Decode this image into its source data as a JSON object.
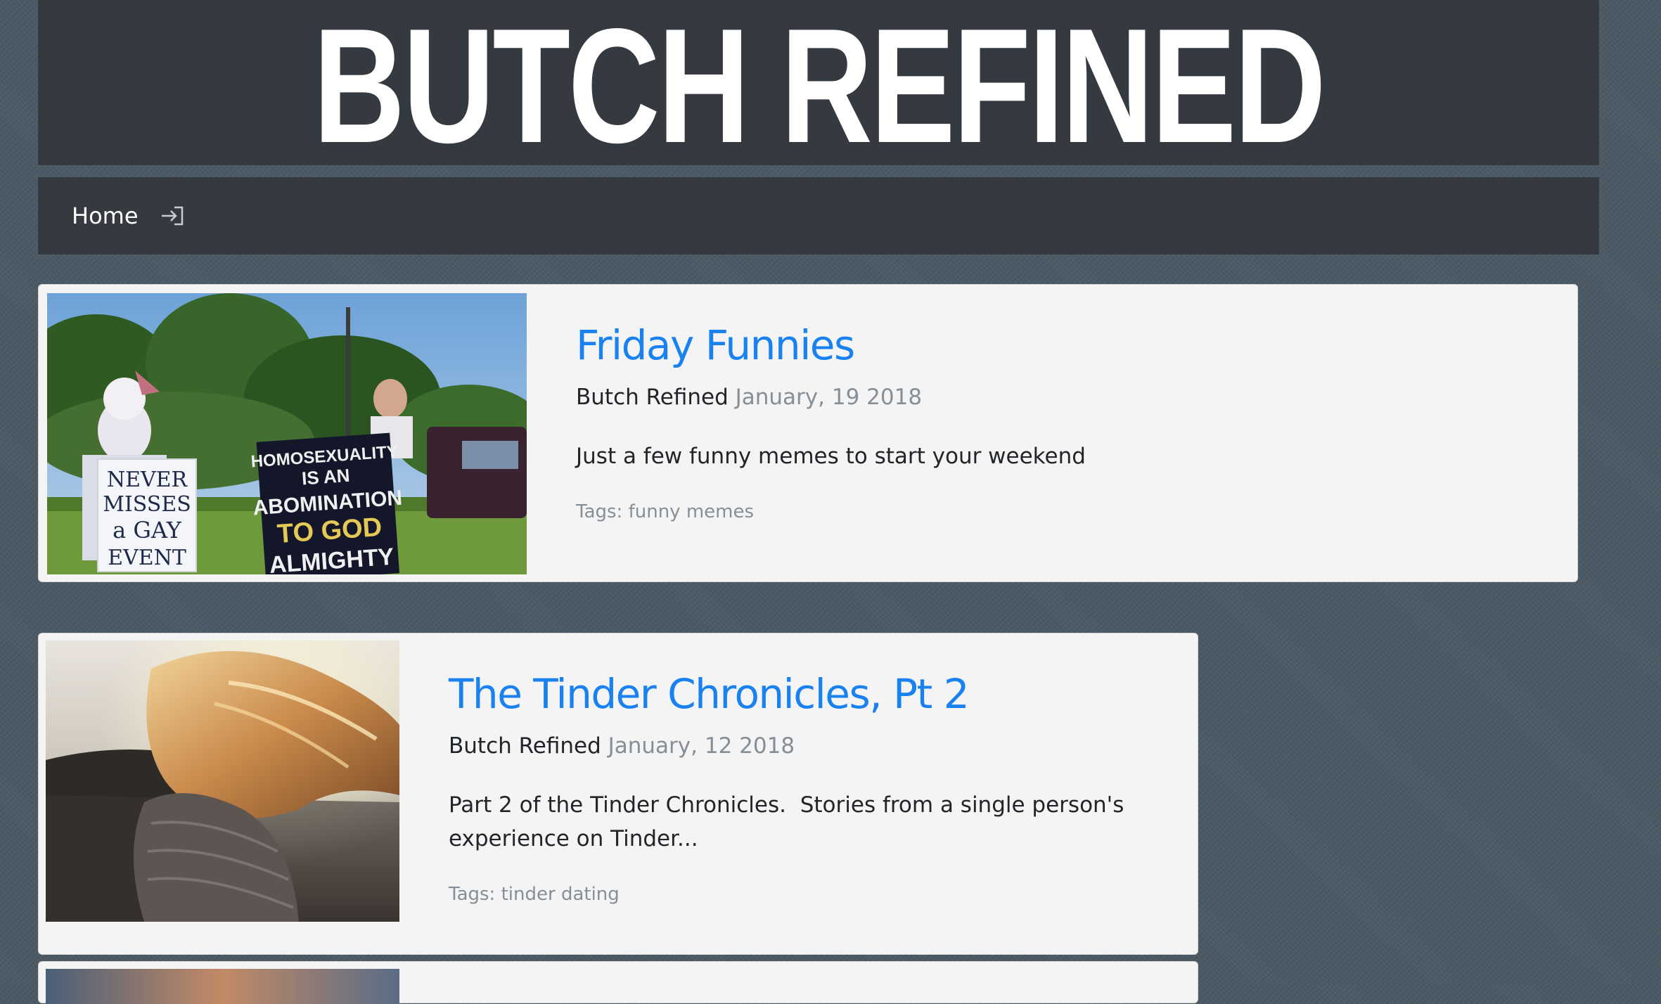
{
  "site": {
    "title": "BUTCH REFINED"
  },
  "nav": {
    "home_label": "Home",
    "login_icon": "login-icon"
  },
  "posts": [
    {
      "title": "Friday Funnies",
      "author": "Butch Refined",
      "date": "January, 19 2018",
      "excerpt": "Just a few funny memes to start your weekend",
      "tags_label": "Tags:",
      "tags": "funny memes",
      "image": {
        "sign_left": [
          "NEVER",
          "MISSES",
          "a GAY",
          "EVENT"
        ],
        "sign_right": [
          "HOMOSEXUALITY",
          "IS AN",
          "ABOMINATION",
          "TO GOD",
          "ALMIGHTY"
        ]
      }
    },
    {
      "title": "The Tinder Chronicles, Pt 2",
      "author": "Butch Refined",
      "date": "January, 12 2018",
      "excerpt_line1": "Part 2 of the Tinder Chronicles.  Stories from a single person's",
      "excerpt_line2": "experience on Tinder...",
      "tags_label": "Tags:",
      "tags": "tinder dating"
    }
  ]
}
